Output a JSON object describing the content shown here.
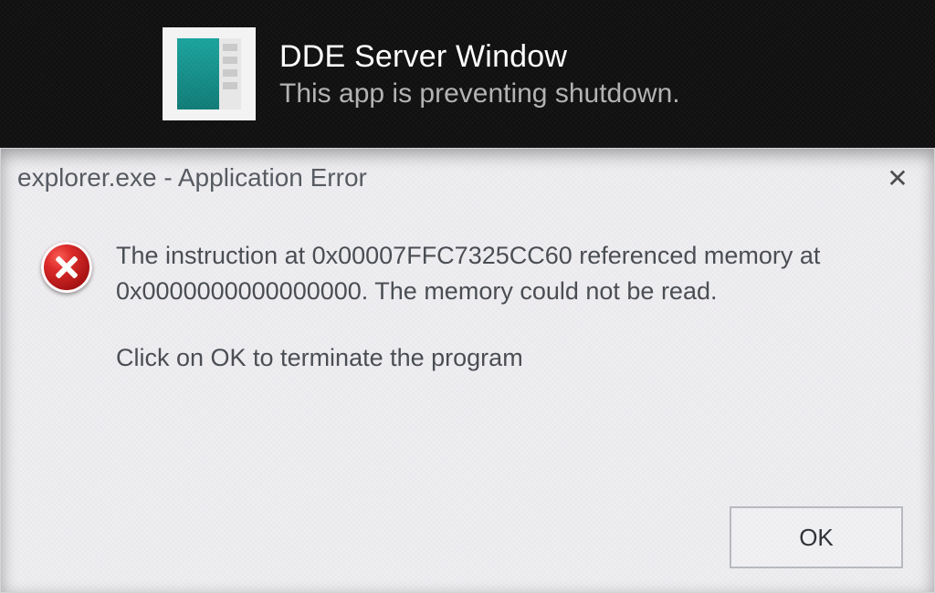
{
  "shutdown_banner": {
    "app_name": "DDE Server Window",
    "status_line": "This app is preventing shutdown."
  },
  "dialog": {
    "title": "explorer.exe - Application Error",
    "message_line1": "The instruction at 0x00007FFC7325CC60 referenced memory at 0x0000000000000000. The memory could not be read.",
    "message_line2": "Click on OK to terminate the program",
    "ok_label": "OK"
  }
}
